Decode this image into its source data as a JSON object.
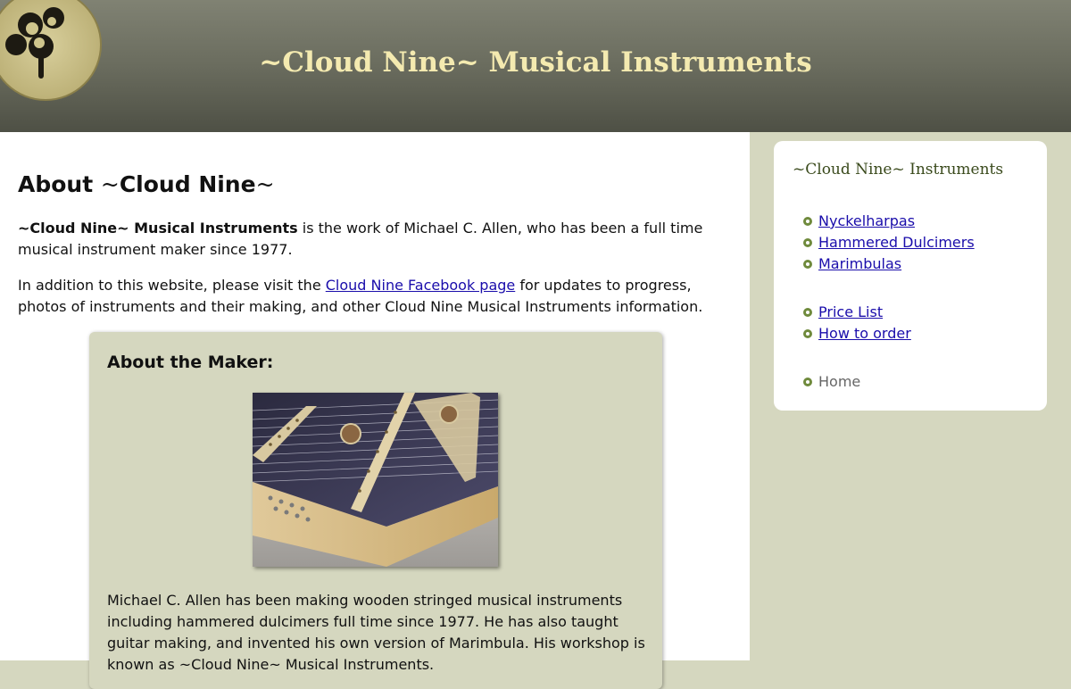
{
  "header": {
    "title": "~Cloud Nine~ Musical Instruments",
    "logo_icon": "cloverleaf-logo-icon"
  },
  "main": {
    "heading": {
      "prefix": "About ",
      "tilde_open": "~",
      "name": "Cloud Nine",
      "tilde_close": "~"
    },
    "intro": {
      "bold": "~Cloud Nine~ Musical Instruments",
      "rest": " is the work of Michael C. Allen, who has been a full time musical instrument maker since 1977."
    },
    "facebook": {
      "before": "In addition to this website, please visit the ",
      "link": "Cloud Nine Facebook page",
      "after": " for updates to progress, photos of instruments and their making, and other Cloud Nine Musical Instruments information."
    },
    "maker": {
      "title": "About the Maker:",
      "photo_icon": "hammered-dulcimer-photo",
      "text": "Michael C. Allen has been making wooden stringed musical instruments including hammered dulcimers full time since 1977. He has also taught guitar making, and invented his own version of Marimbula. His workshop is known as ~Cloud Nine~ Musical Instruments."
    }
  },
  "sidebar": {
    "title": "~Cloud Nine~ Instruments",
    "items": [
      {
        "label": "Nyckelharpas",
        "link": true
      },
      {
        "label": "Hammered Dulcimers",
        "link": true
      },
      {
        "label": "Marimbulas",
        "link": true
      },
      {
        "label": "Price List",
        "link": true
      },
      {
        "label": "How to order",
        "link": true
      },
      {
        "label": "Home",
        "link": false
      }
    ],
    "bullet_icon": "circle-bullet-icon"
  },
  "colors": {
    "header_text": "#f4eab0",
    "sidebar_bg": "#d5d7bf",
    "link": "#1a0dab",
    "bullet": "#6f8a3c"
  }
}
